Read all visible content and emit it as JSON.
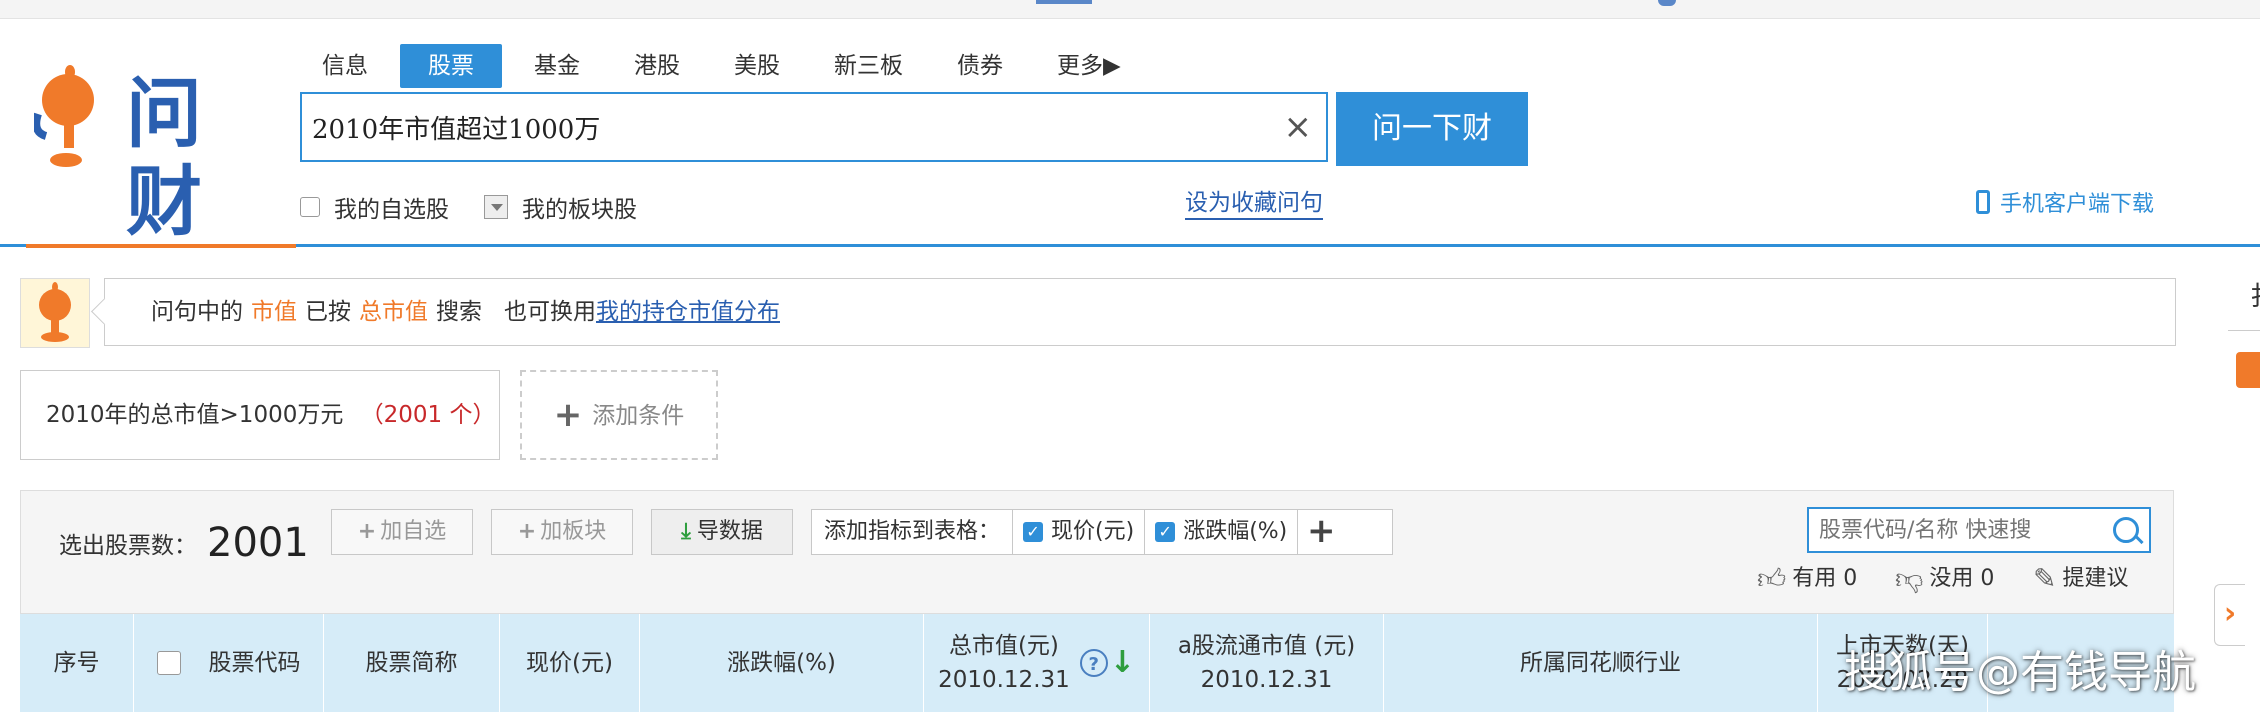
{
  "logo": {
    "text": "问财"
  },
  "nav": [
    "信息",
    "股票",
    "基金",
    "港股",
    "美股",
    "新三板",
    "债券",
    "更多▶"
  ],
  "search": {
    "value": "2010年市值超过1000万",
    "clear_symbol": "×",
    "button_label": "问一下财"
  },
  "options": {
    "my_watchlist": "我的自选股",
    "my_sectors": "我的板块股",
    "save_question": "设为收藏问句",
    "mobile_download": "手机客户端下载"
  },
  "notice": {
    "prefix": "问句中的",
    "term1": "市值",
    "mid": "已按",
    "term2": "总市值",
    "search_word": "搜索",
    "alt": "也可换用",
    "link": "我的持仓市值分布"
  },
  "condition": {
    "text": "2010年的总市值>1000万元",
    "count": "（2001 个）",
    "add_label": "添加条件"
  },
  "toolbar": {
    "count_label": "选出股票数：",
    "count_value": "2001",
    "add_watch": "加自选",
    "add_sector": "加板块",
    "export": "导数据",
    "metrics_label": "添加指标到表格：",
    "metric1": "现价(元)",
    "metric2": "涨跌幅(%)",
    "quick_search_placeholder": "股票代码/名称 快速搜",
    "useful": "有用 0",
    "useless": "没用 0",
    "suggest": "提建议"
  },
  "table_header": {
    "index": "序号",
    "code": "股票代码",
    "name": "股票简称",
    "price": "现价(元)",
    "change": "涨跌幅(%)",
    "market_cap": "总市值(元)",
    "market_cap_date": "2010.12.31",
    "float_cap": "a股流通市值 (元)",
    "float_cap_date": "2010.12.31",
    "industry": "所属同花顺行业",
    "listed_days": "上市天数(天)",
    "listed_days_date": "2020.02.28"
  },
  "side": {
    "edge_text": "扌",
    "tab_arrow": "›"
  },
  "watermark": "搜狐号@有钱导航",
  "colors": {
    "brand_blue": "#2f8fd8",
    "accent_orange": "#f07a2a",
    "count_red": "#c8282a"
  }
}
